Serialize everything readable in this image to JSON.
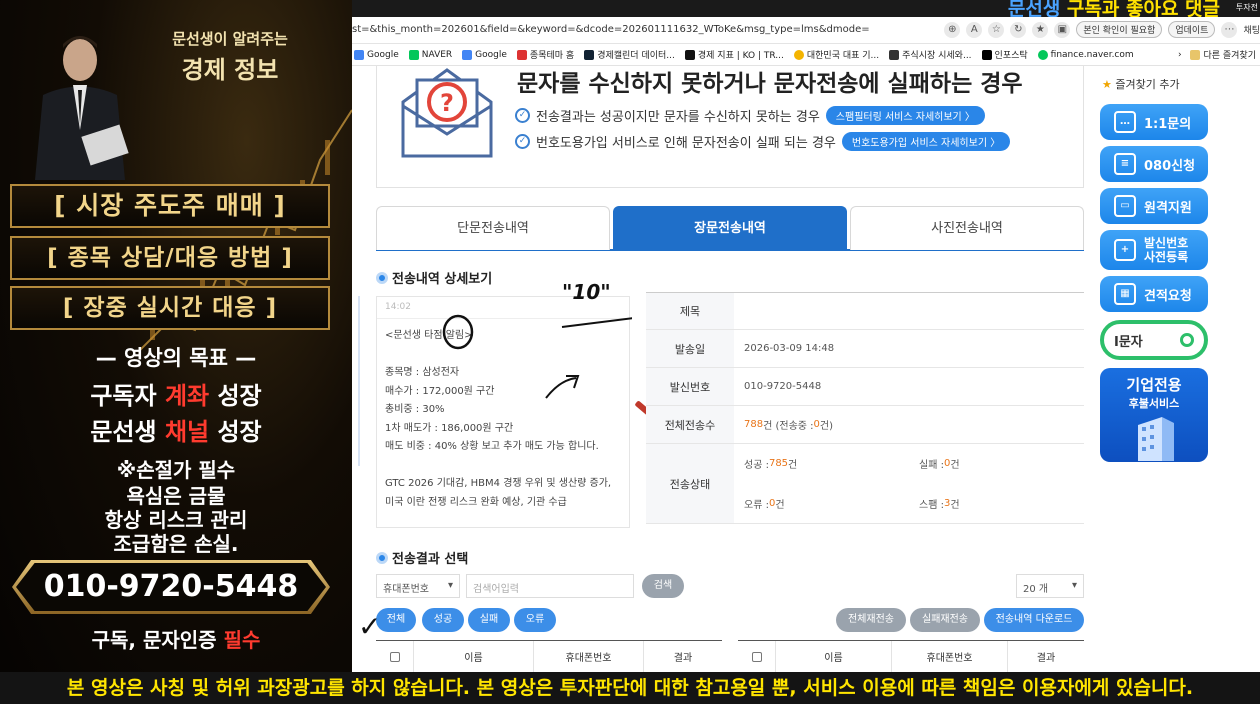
{
  "promo": {
    "title_small": "문선생이 알려주는",
    "title_big": "경제 정보",
    "boxes": [
      "[ 시장 주도주 매매 ]",
      "[ 종목 상담/대응 방법 ]",
      "[ 장중 실시간 대응 ]"
    ],
    "goal_heading": "영상의 목표",
    "goal1_pre": "구독자 ",
    "goal1_red": "계좌",
    "goal1_post": " 성장",
    "goal2_pre": "문선생 ",
    "goal2_red": "채널",
    "goal2_post": " 성장",
    "note1": "※손절가 필수",
    "note2": "욕심은 금물",
    "note3": "항상 리스크 관리",
    "note4": "조급함은 손실.",
    "phone": "010-9720-5448",
    "footer_pre": "구독, 문자인증 ",
    "footer_red": "필수"
  },
  "overlay_caption": {
    "name": "문선생",
    "text": " 구독과 좋아요 댓글",
    "corner": "투자전"
  },
  "browser": {
    "url": "st=&this_month=202601&field=&keyword=&dcode=202601111632_WToKe&msg_type=lms&dmode=",
    "verify_label": "본인 확인이 필요함",
    "update_label": "업데이트",
    "chat_label": "채팅",
    "bookmarks": [
      "Google",
      "NAVER",
      "Google",
      "종목테마 홈",
      "경제캘린더 데이터...",
      "경제 지표 | KO | TR...",
      "대한민국 대표 기...",
      "주식시장 시세와...",
      "인포스탁",
      "finance.naver.com"
    ],
    "other_bookmarks": "다른 즐겨찾기"
  },
  "notice": {
    "title": "문자를 수신하지 못하거나 문자전송에 실패하는 경우",
    "row1_text": "전송결과는 성공이지만 문자를 수신하지 못하는 경우",
    "row1_btn": "스팸필터링 서비스 자세히보기 〉",
    "row2_text": "번호도용가입 서비스로 인해 문자전송이 실패 되는 경우",
    "row2_btn": "번호도용가입 서비스 자세히보기 〉"
  },
  "tabs": [
    "단문전송내역",
    "장문전송내역",
    "사진전송내역"
  ],
  "detail_heading": "전송내역 상세보기",
  "message": {
    "preview_header": "14:02",
    "body": "<문선생 타점 알림>\n\n종목명 : 삼성전자\n매수가 : 172,000원 구간\n총비중 : 30%\n1차 매도가 : 186,000원 구간\n매도 비중 : 40% 상황 보고 추가 매도 가능 합니다.\n\nGTC 2026 기대감, HBM4 경쟁 우위 및 생산량 증가,\n미국 이란 전쟁 리스크 완화 예상, 기관 수급"
  },
  "detail": {
    "subject_label": "제목",
    "subject_value": "",
    "date_label": "발송일",
    "date_value": "2026-03-09 14:48",
    "sender_label": "발신번호",
    "sender_value": "010-9720-5448",
    "total_label": "전체전송수",
    "total_count": "788",
    "total_unit": " 건 (전송중 : ",
    "total_pending": "0",
    "total_end": " 건)",
    "status_label": "전송상태",
    "success_label": "성공 : ",
    "success_count": "785",
    "success_unit": " 건",
    "fail_label": "실패 : ",
    "fail_count": "0",
    "fail_unit": " 건",
    "error_label": "오류 : ",
    "error_count": "0",
    "error_unit": " 건",
    "spam_label": "스팸 : ",
    "spam_count": "3",
    "spam_unit": " 건"
  },
  "annotations": {
    "quote": "\"10\""
  },
  "results_heading": "전송결과 선택",
  "filters": {
    "field_select": "휴대폰번호",
    "search_placeholder": "검색어입력",
    "search_btn": "검색",
    "page_size": "20 개",
    "chips": [
      "전체",
      "성공",
      "실패",
      "오류"
    ],
    "resend_all": "전체재전송",
    "resend_failed": "실패재전송",
    "download": "전송내역 다운로드"
  },
  "table_headers": [
    "이름",
    "휴대폰번호",
    "결과"
  ],
  "sidebar": {
    "favorite": "즐겨찾기 추가",
    "items": [
      "1:1문의",
      "080신청",
      "원격지원",
      "발신번호\n사전등록",
      "견적요청"
    ],
    "search_text": "I문자",
    "banner_line1": "기업전용",
    "banner_line2": "후불서비스"
  },
  "disclaimer": "본 영상은 사칭 및 허위 과장광고를 하지 않습니다. 본 영상은 투자판단에 대한 참고용일 뿐, 서비스 이용에 따른 책임은 이용자에게 있습니다."
}
